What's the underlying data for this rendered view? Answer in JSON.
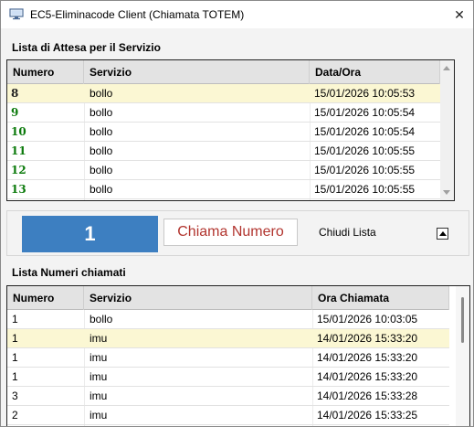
{
  "window": {
    "title": "EC5-Eliminacode Client  (Chiamata TOTEM)",
    "icon": "monitor-icon",
    "close_glyph": "✕"
  },
  "waiting": {
    "section_title": "Lista di Attesa per il Servizio",
    "columns": [
      "Numero",
      "Servizio",
      "Data/Ora"
    ],
    "rows": [
      {
        "numero": "8",
        "servizio": "bollo",
        "data_ora": "15/01/2026 10:05:53"
      },
      {
        "numero": "9",
        "servizio": "bollo",
        "data_ora": "15/01/2026 10:05:54"
      },
      {
        "numero": "10",
        "servizio": "bollo",
        "data_ora": "15/01/2026 10:05:54"
      },
      {
        "numero": "11",
        "servizio": "bollo",
        "data_ora": "15/01/2026 10:05:55"
      },
      {
        "numero": "12",
        "servizio": "bollo",
        "data_ora": "15/01/2026 10:05:55"
      },
      {
        "numero": "13",
        "servizio": "bollo",
        "data_ora": "15/01/2026 10:05:55"
      }
    ]
  },
  "controls": {
    "current_number": "1",
    "call_button_label": "Chiama Numero",
    "close_list_label": "Chiudi Lista",
    "collapse_icon": "triangle-up-icon"
  },
  "called": {
    "section_title": "Lista Numeri chiamati",
    "columns": [
      "Numero",
      "Servizio",
      "Ora Chiamata"
    ],
    "rows": [
      {
        "numero": "1",
        "servizio": "bollo",
        "ora": "15/01/2026 10:03:05"
      },
      {
        "numero": "1",
        "servizio": "imu",
        "ora": "14/01/2026 15:33:20"
      },
      {
        "numero": "1",
        "servizio": "imu",
        "ora": "14/01/2026 15:33:20"
      },
      {
        "numero": "1",
        "servizio": "imu",
        "ora": "14/01/2026 15:33:20"
      },
      {
        "numero": "3",
        "servizio": "imu",
        "ora": "14/01/2026 15:33:28"
      },
      {
        "numero": "2",
        "servizio": "imu",
        "ora": "14/01/2026 15:33:25"
      }
    ]
  },
  "colors": {
    "accent_blue": "#3d7fc1",
    "call_text_red": "#b2352f",
    "number_green": "#0b7a0b",
    "selected_row": "#fbf7d3"
  }
}
